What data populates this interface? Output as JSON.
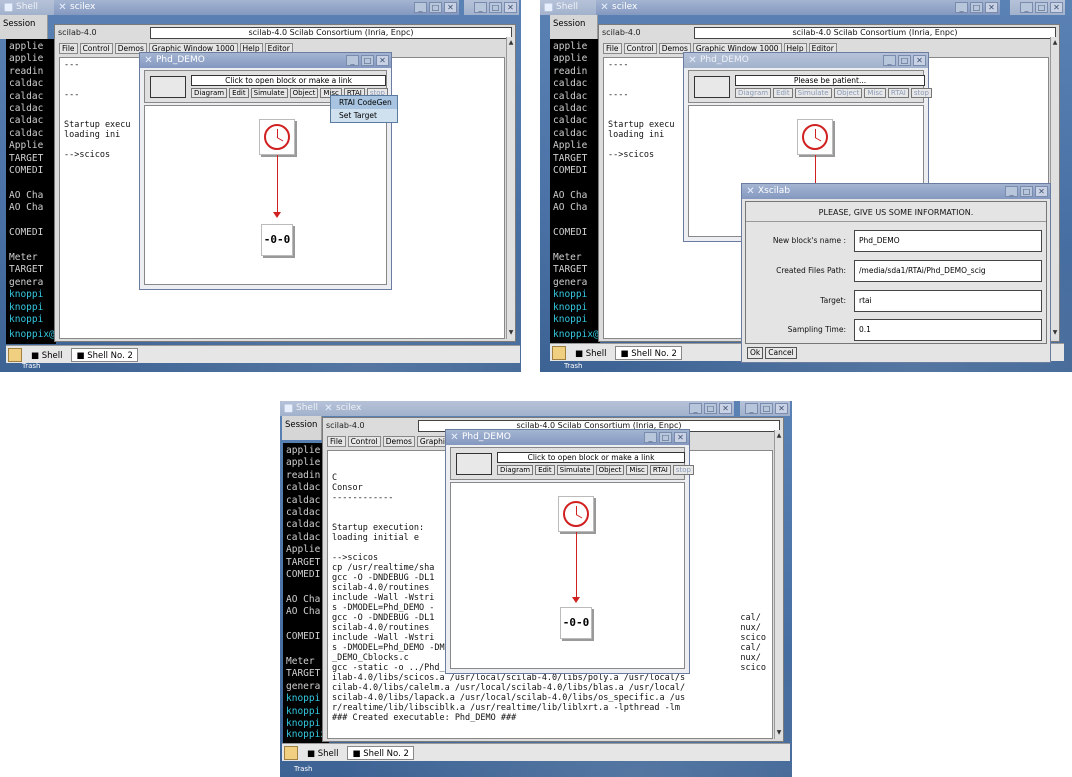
{
  "shell": {
    "tab_session": "Session",
    "prompt": "knoppix@2[RTAi]$ ",
    "taskbar_shell": "Shell",
    "taskbar_shell2": "Shell No. 2",
    "trash": "Trash",
    "bg_title": "Shell",
    "xterm_title": "scilex"
  },
  "term_lines": [
    "applie",
    "applie",
    "readin",
    "caldac",
    "caldac",
    "caldac",
    "caldac",
    "caldac",
    "Applie",
    "TARGET",
    "COMEDI",
    "",
    "AO Cha",
    "AO Cha",
    "",
    "COMEDI",
    "",
    "Meter ",
    "TARGET",
    "genera",
    "knoppi",
    "knoppi",
    "knoppi"
  ],
  "scilab": {
    "version": "scilab-4.0",
    "title": "scilab-4.0 Scilab Consortium (Inria, Enpc)",
    "menu": [
      "File",
      "Control",
      "Demos",
      "Graphic Window 1000",
      "Help",
      "Editor"
    ],
    "console_p1": [
      "---",
      "",
      "",
      "---",
      "",
      "",
      "Startup execu",
      "  loading ini",
      "",
      "-->scicos"
    ],
    "console_p2": [
      "----",
      "",
      "",
      "----",
      "",
      "",
      "Startup execu",
      "  loading ini",
      "",
      "-->scicos"
    ],
    "console_p3": [
      "",
      "",
      "C",
      "Consor",
      "------------",
      "",
      "",
      "Startup execution:",
      "  loading initial e",
      "",
      "-->scicos",
      "cp /usr/realtime/sha",
      "gcc -O -DNDEBUG -DL1",
      "scilab-4.0/routines ",
      "include -Wall -Wstri",
      "s -DMODEL=Phd_DEMO -",
      "gcc -O -DNDEBUG -DL1",
      "scilab-4.0/routines ",
      "include -Wall -Wstri",
      "s -DMODEL=Phd_DEMO -DMODELN=Phd_DEMO.c    -c -o Phd_DEMO_Cblocks.o Phd",
      "_DEMO_Cblocks.c",
      "gcc -static -o ../Phd_DEMO  rtmain.o Phd_DEMO_Cblocks.o /usr/local/sc",
      "ilab-4.0/libs/scicos.a /usr/local/scilab-4.0/libs/poly.a /usr/local/s",
      "cilab-4.0/libs/calelm.a /usr/local/scilab-4.0/libs/blas.a /usr/local/",
      "scilab-4.0/libs/lapack.a /usr/local/scilab-4.0/libs/os_specific.a /us",
      "r/realtime/lib/libsciblk.a /usr/realtime/lib/liblxrt.a -lpthread -lm",
      "### Created executable: Phd_DEMO ###"
    ],
    "console_p3_right": [
      "cal/",
      "nux/",
      "scico",
      "cal/",
      "nux/",
      "scico"
    ]
  },
  "scicos": {
    "title": "Phd_DEMO",
    "hint": "Click to open block or make a link",
    "hint_patient": "Please be patient...",
    "menu": [
      "Diagram",
      "Edit",
      "Simulate",
      "Object",
      "Misc",
      "RTAI",
      "stop"
    ],
    "rtai_menu": [
      "RTAI CodeGen",
      "Set Target"
    ],
    "block_glyph": "-0-0"
  },
  "xscilab": {
    "title": "Xscilab",
    "header": "PLEASE, GIVE US SOME INFORMATION.",
    "fields": [
      {
        "label": "New block's name :",
        "value": "Phd_DEMO"
      },
      {
        "label": "Created Files Path:",
        "value": "/media/sda1/RTAi/Phd_DEMO_scig"
      },
      {
        "label": "Target:",
        "value": "rtai"
      },
      {
        "label": "Sampling Time:",
        "value": "0.1"
      }
    ],
    "ok": "Ok",
    "cancel": "Cancel"
  }
}
